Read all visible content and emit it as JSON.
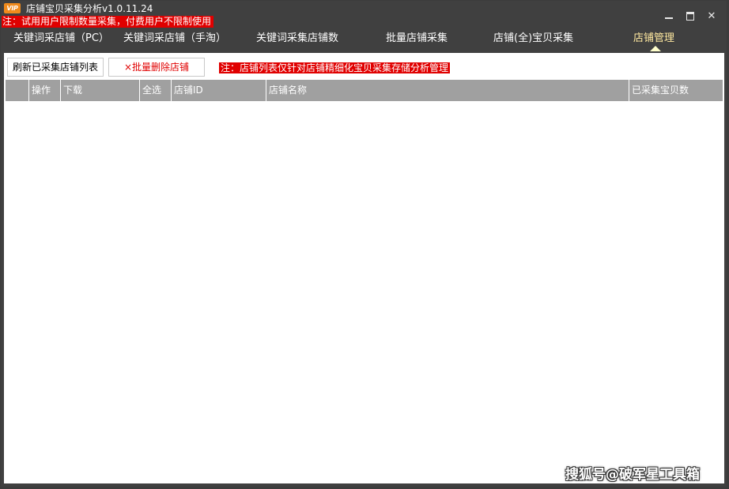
{
  "titlebar": {
    "logo_text": "VIP",
    "app_title": "店铺宝贝采集分析v1.0.11.24",
    "trial_notice": "注：试用用户限制数量采集，付费用户不限制使用"
  },
  "tabs": [
    {
      "label": "关键词采店铺（PC）"
    },
    {
      "label": "关键词采店铺（手淘）"
    },
    {
      "label": "关键词采集店铺数"
    },
    {
      "label": "批量店铺采集"
    },
    {
      "label": "店铺(全)宝贝采集"
    },
    {
      "label": "店铺管理",
      "active": true
    }
  ],
  "toolbar": {
    "refresh_label": "刷新已采集店铺列表",
    "delete_label": "×批量删除店铺",
    "note": "注：店铺列表仅针对店铺精细化宝贝采集存储分析管理"
  },
  "table": {
    "columns": [
      "",
      "操作",
      "下载",
      "全选",
      "店铺ID",
      "店铺名称",
      "已采集宝贝数"
    ],
    "rows": []
  },
  "watermark": "搜狐号@破军星工具箱",
  "colors": {
    "window_bg": "#404040",
    "header_bg": "#a0a0a0",
    "alert_red": "#e00000",
    "active_tab": "#ffe9a0"
  }
}
